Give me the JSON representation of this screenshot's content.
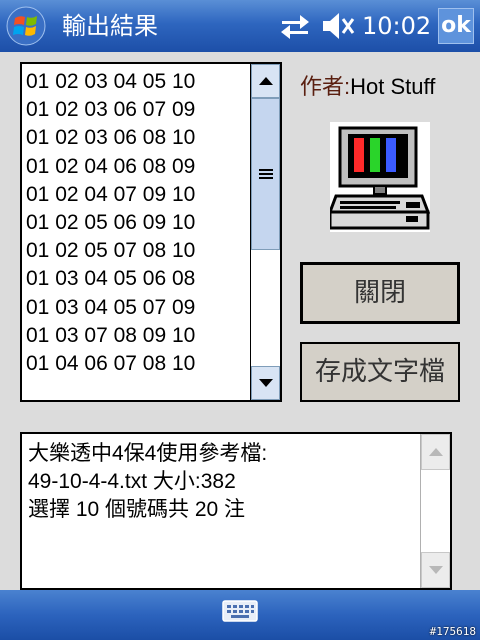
{
  "titlebar": {
    "title": "輸出結果",
    "clock": "10:02",
    "ok_label": "ok",
    "icons": [
      "windows-start-icon",
      "connectivity-arrows-icon",
      "speaker-muted-icon"
    ]
  },
  "list": {
    "rows": [
      "01 02 03 04 05 10",
      "01 02 03 06 07 09",
      "01 02 03 06 08 10",
      "01 02 04 06 08 09",
      "01 02 04 07 09 10",
      "01 02 05 06 09 10",
      "01 02 05 07 08 10",
      "01 03 04 05 06 08",
      "01 03 04 05 07 09",
      "01 03 07 08 09 10",
      "01 04 06 07 08 10"
    ]
  },
  "author": {
    "label": "作者:",
    "name": "Hot Stuff"
  },
  "buttons": {
    "close": "關閉",
    "save": "存成文字檔"
  },
  "info": {
    "text": "大樂透中4保4使用參考檔:\n49-10-4-4.txt 大小:382\n選擇 10 個號碼共 20 注"
  },
  "footer": {
    "watermark": "#175618"
  },
  "colors": {
    "titlebar": "#2e66bf",
    "background": "#dcdcdc",
    "button_face": "#d4d0c8",
    "scrollbar": "#c5d6ef"
  }
}
